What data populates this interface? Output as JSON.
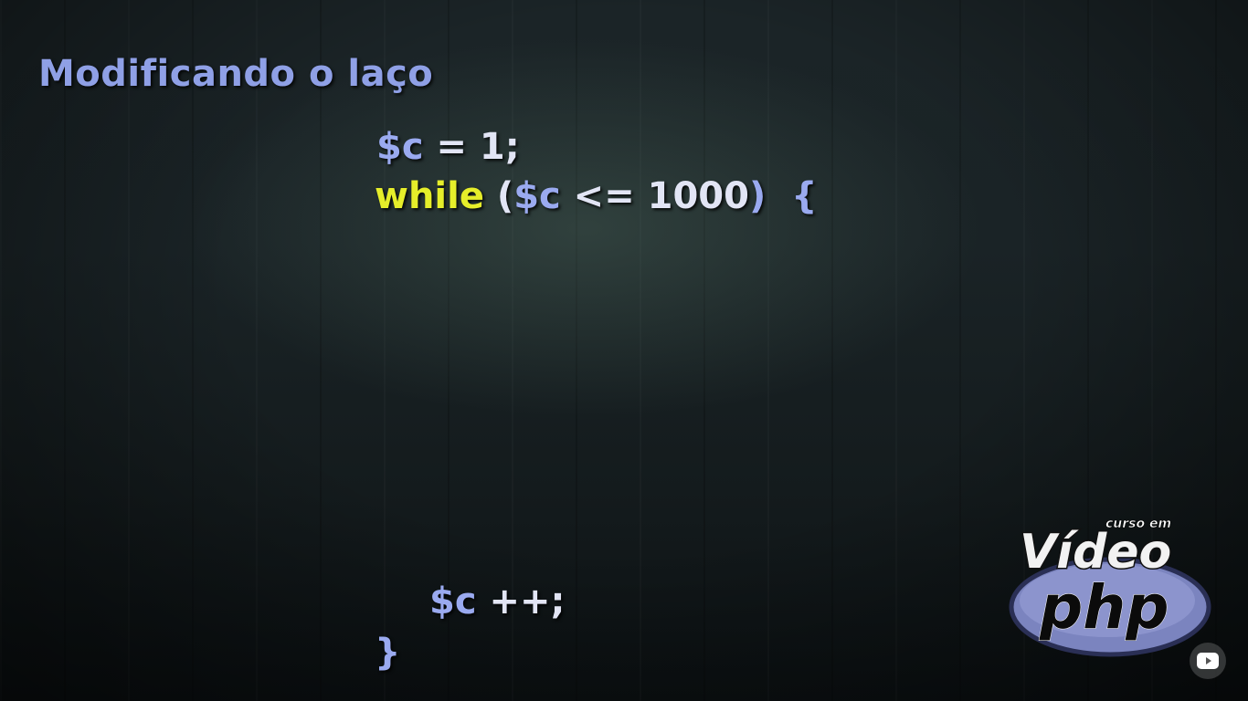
{
  "slide": {
    "title": "Modificando o laço"
  },
  "code": {
    "line1": {
      "var": "$c",
      "rest": " = 1;"
    },
    "line2": {
      "keyword": "while",
      "open": " (",
      "var": "$c",
      "cond": " <= 1000",
      "close": ")  {"
    },
    "line3": {
      "var": "$c",
      "rest": " ++;"
    },
    "line4": {
      "close_brace": "}"
    }
  },
  "logo": {
    "small_text": "curso em",
    "main_text": "Vídeo",
    "brand_text": "php"
  },
  "player": {
    "youtube_icon": "youtube-icon"
  },
  "colors": {
    "title": "#8fa0e6",
    "variable": "#9aaaf0",
    "keyword": "#e6ee2a",
    "operator": "#e2e5f5"
  }
}
